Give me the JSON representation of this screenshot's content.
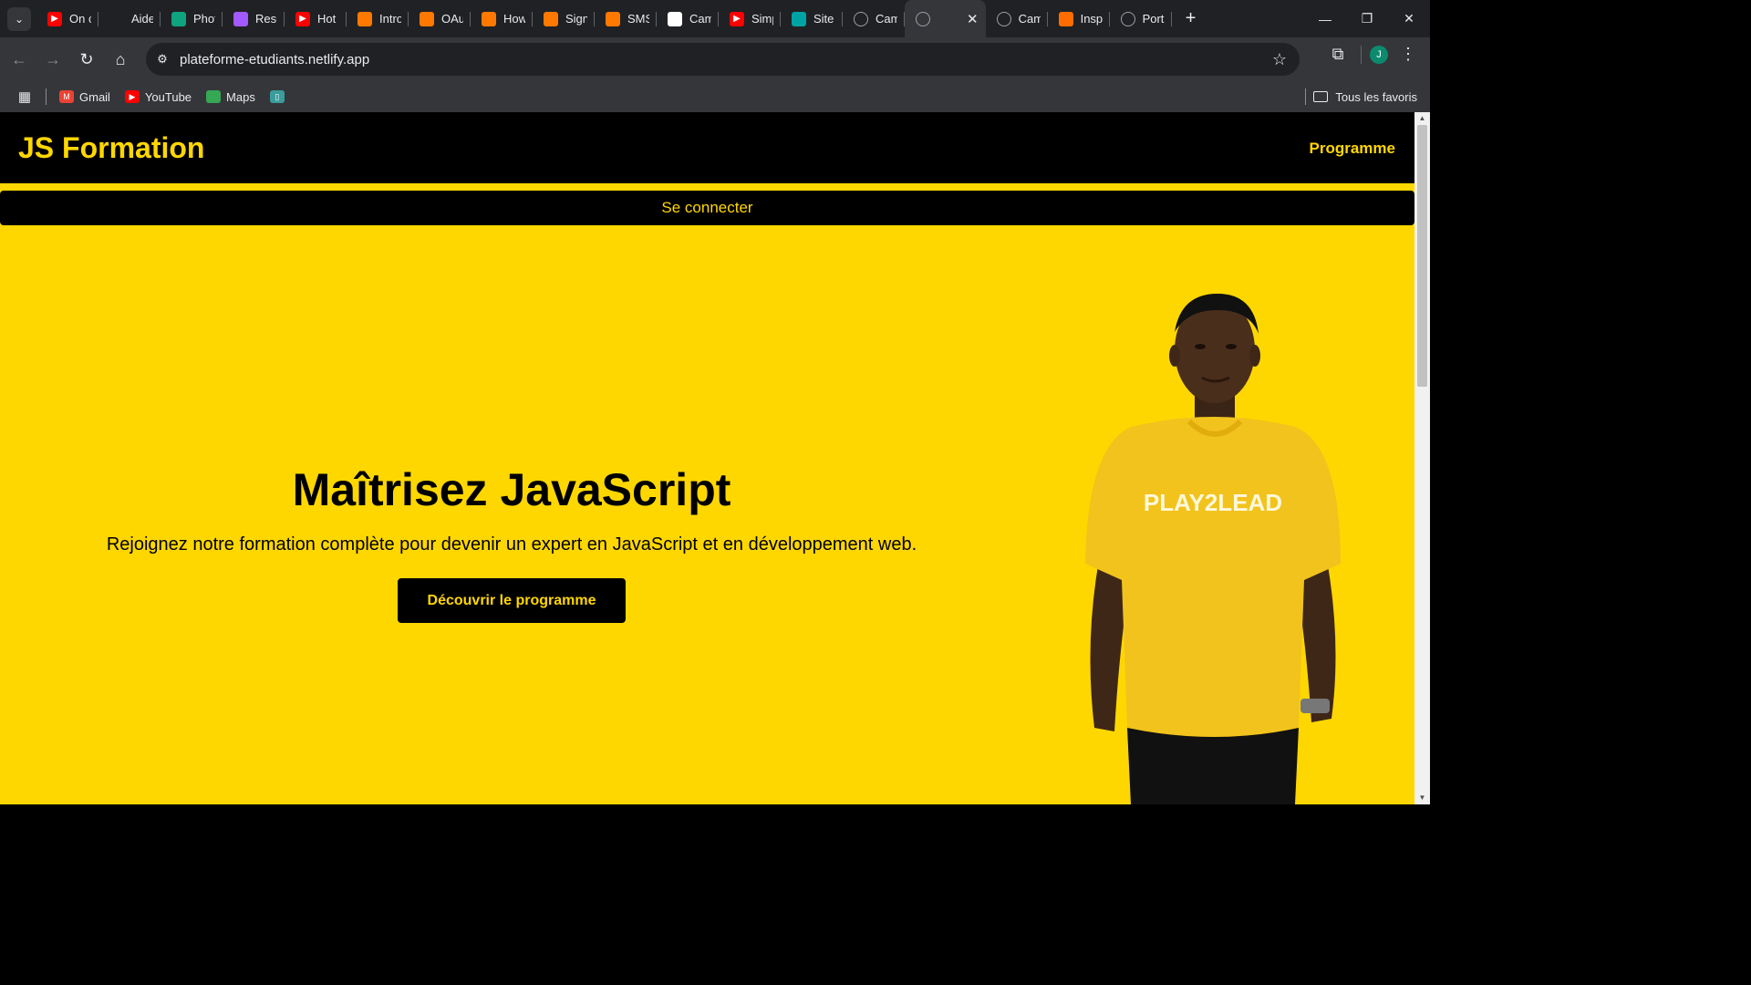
{
  "browser": {
    "tabs": [
      {
        "title": "On c",
        "icon": "youtube-icon",
        "color": "#ff0000"
      },
      {
        "title": "Aide",
        "icon": "openai-icon",
        "color": "#202124"
      },
      {
        "title": "Phot",
        "icon": "photoroom-icon",
        "color": "#10a37f"
      },
      {
        "title": "Resu",
        "icon": "figma-icon",
        "color": "#a259ff"
      },
      {
        "title": "Hot",
        "icon": "youtube-icon",
        "color": "#ff0000"
      },
      {
        "title": "Intro",
        "icon": "orange-icon",
        "color": "#ff7900"
      },
      {
        "title": "OAu",
        "icon": "orange-icon",
        "color": "#ff7900"
      },
      {
        "title": "How",
        "icon": "orange-icon",
        "color": "#ff7900"
      },
      {
        "title": "Sign",
        "icon": "orange-icon",
        "color": "#ff7900"
      },
      {
        "title": "SMS",
        "icon": "orange-icon",
        "color": "#ff7900"
      },
      {
        "title": "Cam",
        "icon": "document-icon",
        "color": "#ffffff"
      },
      {
        "title": "Simp",
        "icon": "youtube-icon",
        "color": "#ff0000"
      },
      {
        "title": "Site",
        "icon": "diamond-icon",
        "color": "#00a3a3"
      },
      {
        "title": "Cam",
        "icon": "globe-icon",
        "color": "#5f6368"
      },
      {
        "title": "",
        "icon": "globe-icon",
        "color": "#5f6368",
        "active": true
      },
      {
        "title": "Cam",
        "icon": "globe-icon",
        "color": "#5f6368"
      },
      {
        "title": "Insp",
        "icon": "fire-icon",
        "color": "#ff6d00"
      },
      {
        "title": "Port",
        "icon": "globe-icon",
        "color": "#5f6368"
      }
    ],
    "url": "plateforme-etudiants.netlify.app",
    "avatar_letter": "J",
    "bookmarks": [
      {
        "label": "Gmail",
        "icon": "gmail-icon",
        "color": "#ea4335"
      },
      {
        "label": "YouTube",
        "icon": "youtube-icon",
        "color": "#ff0000"
      },
      {
        "label": "Maps",
        "icon": "maps-icon",
        "color": "#34a853"
      }
    ],
    "all_bookmarks_label": "Tous les favoris"
  },
  "site": {
    "brand": "JS Formation",
    "nav": {
      "program": "Programme"
    },
    "login_label": "Se connecter",
    "hero": {
      "title": "Maîtrisez JavaScript",
      "subtitle": "Rejoignez notre formation complète pour devenir un expert en JavaScript et en développement web.",
      "cta": "Découvrir le programme",
      "shirt_text": "PLAY2LEAD"
    },
    "colors": {
      "accent": "#ffd700",
      "dark": "#000000"
    }
  }
}
